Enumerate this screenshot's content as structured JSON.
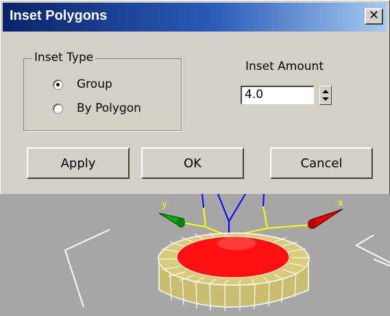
{
  "window": {
    "title": "Inset Polygons",
    "close_glyph": "✕"
  },
  "inset_type": {
    "label": "Inset Type",
    "options": [
      {
        "label": "Group",
        "checked": true
      },
      {
        "label": "By Polygon",
        "checked": false
      }
    ]
  },
  "inset_amount": {
    "label": "Inset Amount",
    "value": "4.0"
  },
  "buttons": {
    "apply": "Apply",
    "ok": "OK",
    "cancel": "Cancel"
  },
  "viewport": {
    "axis_labels": {
      "x": "x",
      "y": "y"
    },
    "colors": {
      "background": "#a6a6a6",
      "selected_face": "#ff1010",
      "ring": "#d8cc7a",
      "wire": "#ffffff",
      "x_axis": "#ff0000",
      "y_axis": "#00c000",
      "z_axis": "#0000ff",
      "gizmo": "#ffff00"
    }
  }
}
